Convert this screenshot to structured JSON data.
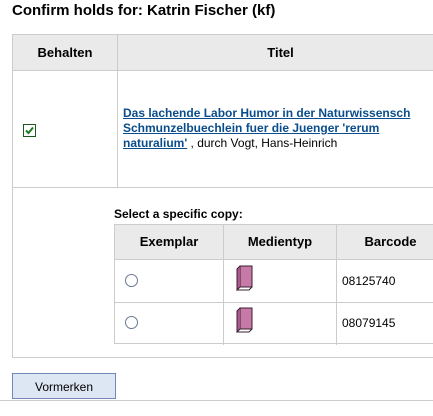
{
  "page": {
    "title": "Confirm holds for: Katrin Fischer (kf)"
  },
  "holds_table": {
    "columns": [
      "Behalten",
      "Titel"
    ],
    "row": {
      "keep_checked": true,
      "title_lines": [
        "Das lachende Labor Humor in der Naturwissensch",
        "Schmunzelbuechlein fuer die Juenger 'rerum",
        "naturalium'"
      ],
      "author_text": " , durch Vogt, Hans-Heinrich"
    }
  },
  "copy_select": {
    "heading": "Select a specific copy:",
    "columns": [
      "Exemplar",
      "Medientyp",
      "Barcode"
    ],
    "items": [
      {
        "selected": false,
        "media_icon": "book-icon",
        "barcode": "08125740"
      },
      {
        "selected": false,
        "media_icon": "book-icon",
        "barcode": "08079145"
      }
    ]
  },
  "actions": {
    "submit_label": "Vormerken"
  },
  "colors": {
    "link": "#0a4d8c",
    "header_bg": "#eaeaea",
    "book_icon": "#c77aa8"
  }
}
